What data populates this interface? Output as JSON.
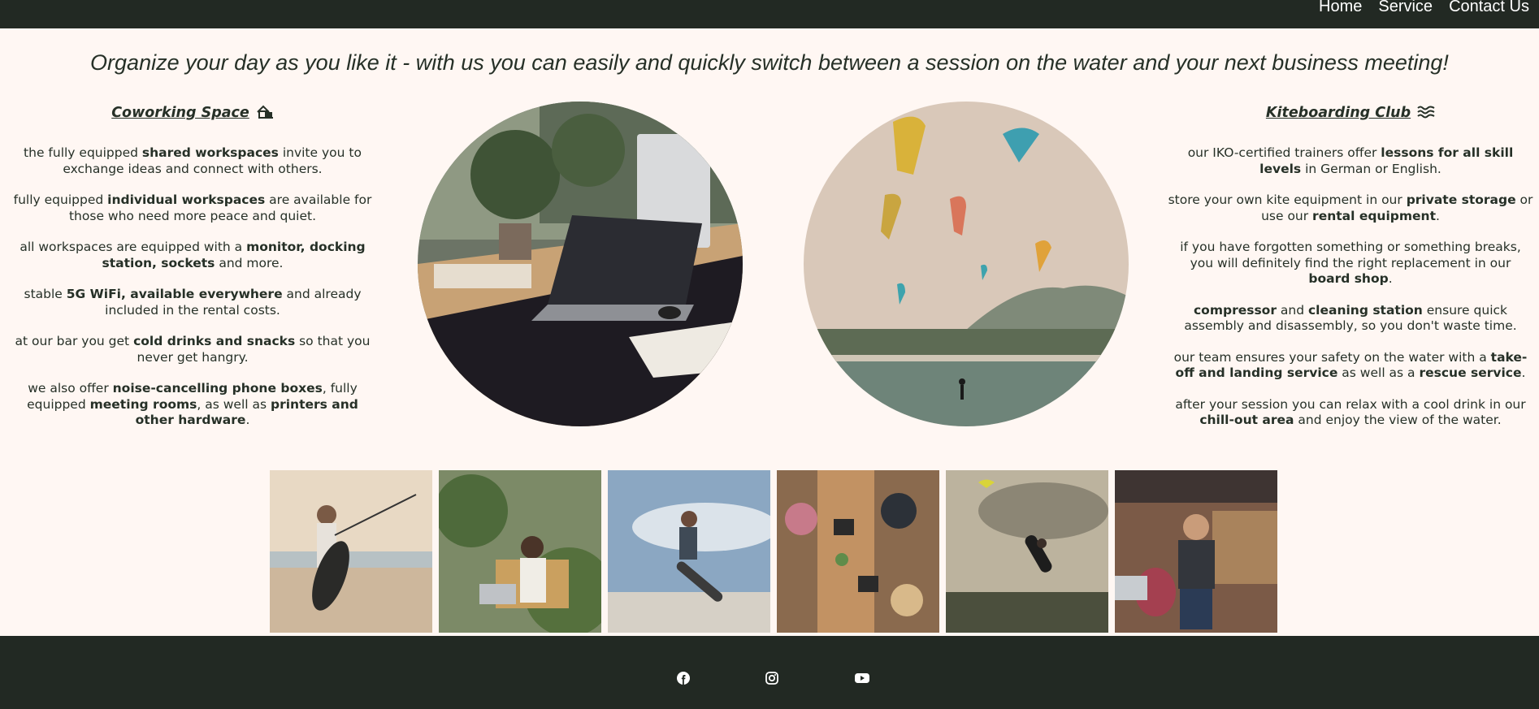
{
  "nav": {
    "items": [
      "Home",
      "Service",
      "Contact Us"
    ]
  },
  "tagline": "Organize your day as you like it - with us you can easily and quickly switch between a session on the water and your next business meeting!",
  "coworking": {
    "title": "Coworking Space",
    "icon": "house-laptop-icon",
    "items": [
      {
        "a": "the fully equipped ",
        "b": "shared workspaces",
        "c": " invite you to exchange ideas and connect with others."
      },
      {
        "a": "fully equipped ",
        "b": "individual workspaces",
        "c": " are available for those who need more peace and quiet."
      },
      {
        "a": "all workspaces are equipped with a ",
        "b": "monitor, docking station, sockets",
        "c": " and more."
      },
      {
        "a": "stable ",
        "b": "5G WiFi, available everywhere",
        "c": " and already included in the rental costs."
      },
      {
        "a": "at our bar you get ",
        "b": "cold drinks and snacks",
        "c": " so that you never get hangry."
      },
      {
        "a": "we also offer ",
        "b": "noise-cancelling phone boxes",
        "c": ", fully equipped ",
        "d": "meeting rooms",
        "e": ", as well as ",
        "f": "printers and other hardware",
        "g": "."
      }
    ]
  },
  "kite": {
    "title": "Kiteboarding Club",
    "icon": "water-waves-icon",
    "items": [
      {
        "a": "our IKO-certified trainers offer ",
        "b": "lessons for all skill levels",
        "c": " in German or English."
      },
      {
        "a": "store your own kite equipment in our ",
        "b": "private storage",
        "c": " or use our ",
        "d": "rental equipment",
        "e": "."
      },
      {
        "a": "if you have forgotten something or something breaks, you will definitely find the right replacement in our ",
        "b": "board shop",
        "c": "."
      },
      {
        "a": "",
        "b": "compressor",
        "c": " and ",
        "d": "cleaning station",
        "e": " ensure quick assembly and disassembly, so you don't waste time."
      },
      {
        "a": "our team ensures your safety on the water with a ",
        "b": "take-off and landing service",
        "c": " as well as a ",
        "d": "rescue service",
        "e": "."
      },
      {
        "a": "after your session you can relax with a cool drink in our ",
        "b": "chill-out area",
        "c": " and enjoy the view of the water."
      }
    ]
  },
  "images": {
    "circle_left": "desk-with-laptop-photo",
    "circle_right": "kites-over-beach-photo",
    "gallery": [
      "kitesurfer-on-beach-photo",
      "person-with-laptop-among-plants-photo",
      "kitesurfer-jumping-photo",
      "people-at-shared-desk-photo",
      "kiteboarder-in-air-photo",
      "man-laughing-in-cafe-photo"
    ]
  },
  "footer": {
    "icons": [
      "facebook-icon",
      "instagram-icon",
      "youtube-icon"
    ]
  },
  "colors": {
    "background": "#fff7f3",
    "dark": "#222923",
    "text": "#263027"
  }
}
